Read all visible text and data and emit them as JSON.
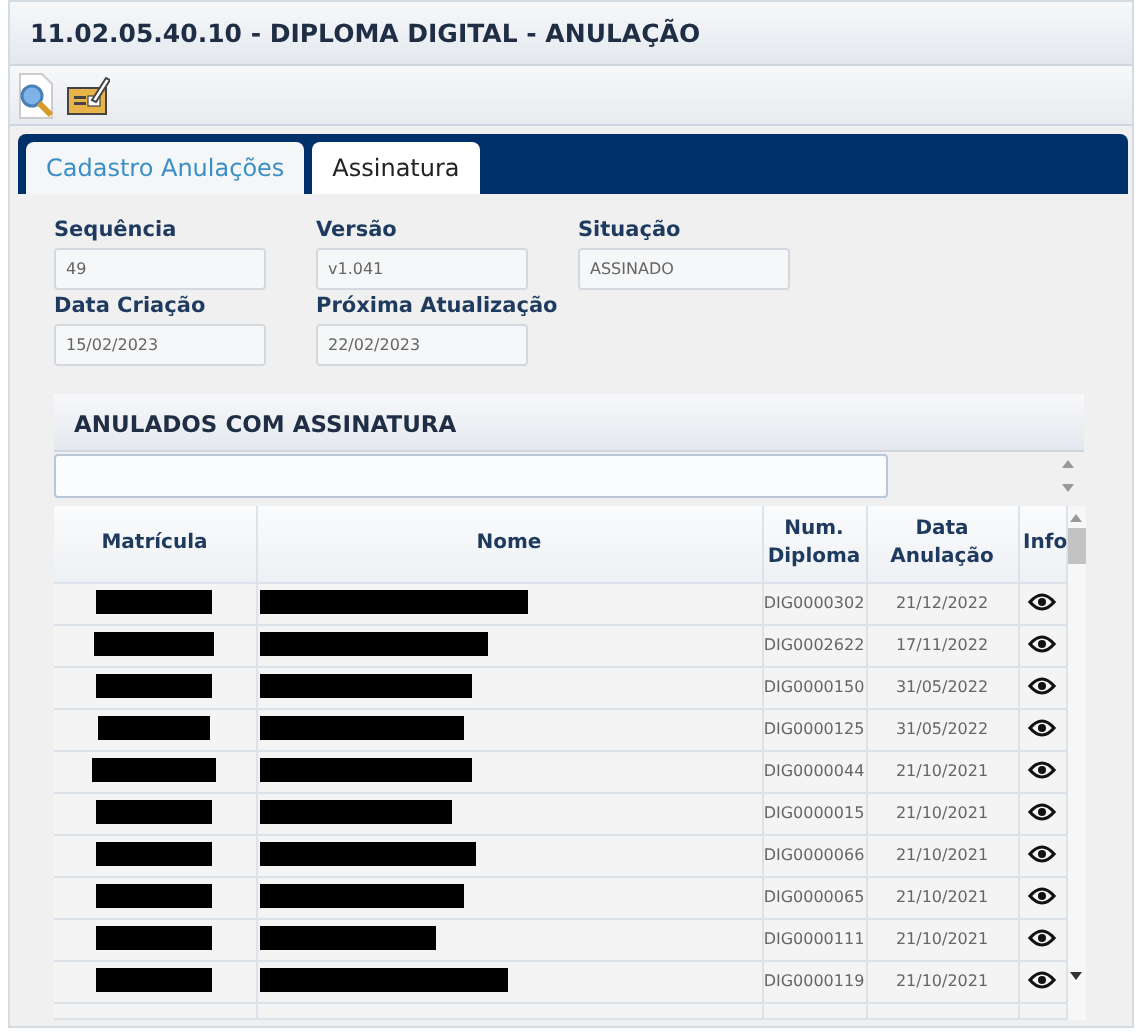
{
  "window": {
    "title": "11.02.05.40.10 - DIPLOMA DIGITAL - ANULAÇÃO"
  },
  "tabs": [
    {
      "label": "Cadastro Anulações",
      "selected": false
    },
    {
      "label": "Assinatura",
      "selected": true
    }
  ],
  "form": [
    {
      "label": "Sequência",
      "value": "49"
    },
    {
      "label": "Versão",
      "value": "v1.041"
    },
    {
      "label": "Situação",
      "value": "ASSINADO"
    },
    {
      "label": "Data Criação",
      "value": "15/02/2023"
    },
    {
      "label": "Próxima Atualização",
      "value": "22/02/2023"
    }
  ],
  "grid": {
    "title": "ANULADOS COM ASSINATURA",
    "columns": [
      "Matrícula",
      "Nome",
      "Num. Diploma",
      "Data Anulação",
      "Info"
    ],
    "rows": [
      {
        "num_diploma": "DIG0000302",
        "data_anulacao": "21/12/2022"
      },
      {
        "num_diploma": "DIG0002622",
        "data_anulacao": "17/11/2022"
      },
      {
        "num_diploma": "DIG0000150",
        "data_anulacao": "31/05/2022"
      },
      {
        "num_diploma": "DIG0000125",
        "data_anulacao": "31/05/2022"
      },
      {
        "num_diploma": "DIG0000044",
        "data_anulacao": "21/10/2021"
      },
      {
        "num_diploma": "DIG0000015",
        "data_anulacao": "21/10/2021"
      },
      {
        "num_diploma": "DIG0000066",
        "data_anulacao": "21/10/2021"
      },
      {
        "num_diploma": "DIG0000065",
        "data_anulacao": "21/10/2021"
      },
      {
        "num_diploma": "DIG0000111",
        "data_anulacao": "21/10/2021"
      },
      {
        "num_diploma": "DIG0000119",
        "data_anulacao": "21/10/2021"
      }
    ]
  }
}
